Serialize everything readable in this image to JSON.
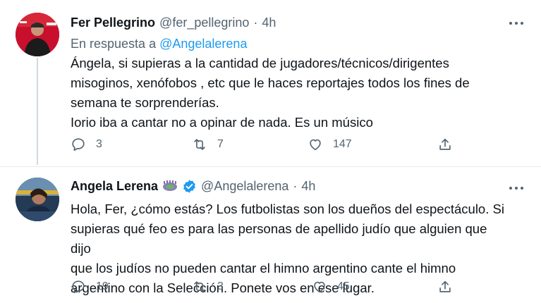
{
  "tweets": [
    {
      "display_name": "Fer Pellegrino",
      "handle": "@fer_pellegrino",
      "separator": "·",
      "time": "4h",
      "reply_prefix": "En respuesta a",
      "reply_handle": "@Angelalerena",
      "body_lines": [
        "Ángela, si supieras a la cantidad de jugadores/técnicos/dirigentes",
        "misoginos, xenófobos , etc que le haces reportajes todos los fines de",
        "semana te sorprenderías.",
        "Iorio iba a cantar no a opinar de nada. Es un músico"
      ],
      "replies": "3",
      "retweets": "7",
      "likes": "147"
    },
    {
      "display_name": "Angela Lerena",
      "emoji_icon": "stadium-emoji-icon",
      "verified_icon": "verified-badge-icon",
      "handle": "@Angelalerena",
      "separator": "·",
      "time": "4h",
      "body_lines": [
        "Hola, Fer, ¿cómo estás? Los futbolistas son los dueños del espectáculo. Si",
        "supieras qué feo es para las personas de apellido judío que alguien que dijo",
        "que los judíos no pueden cantar el himno argentino cante el himno",
        "argentino con la Selección. Ponete vos en ese lugar."
      ],
      "replies": "19",
      "retweets": "3",
      "likes": "45"
    }
  ],
  "colors": {
    "link": "#1d9bf0",
    "secondary_text": "#536471",
    "verified": "#1d9bf0"
  }
}
